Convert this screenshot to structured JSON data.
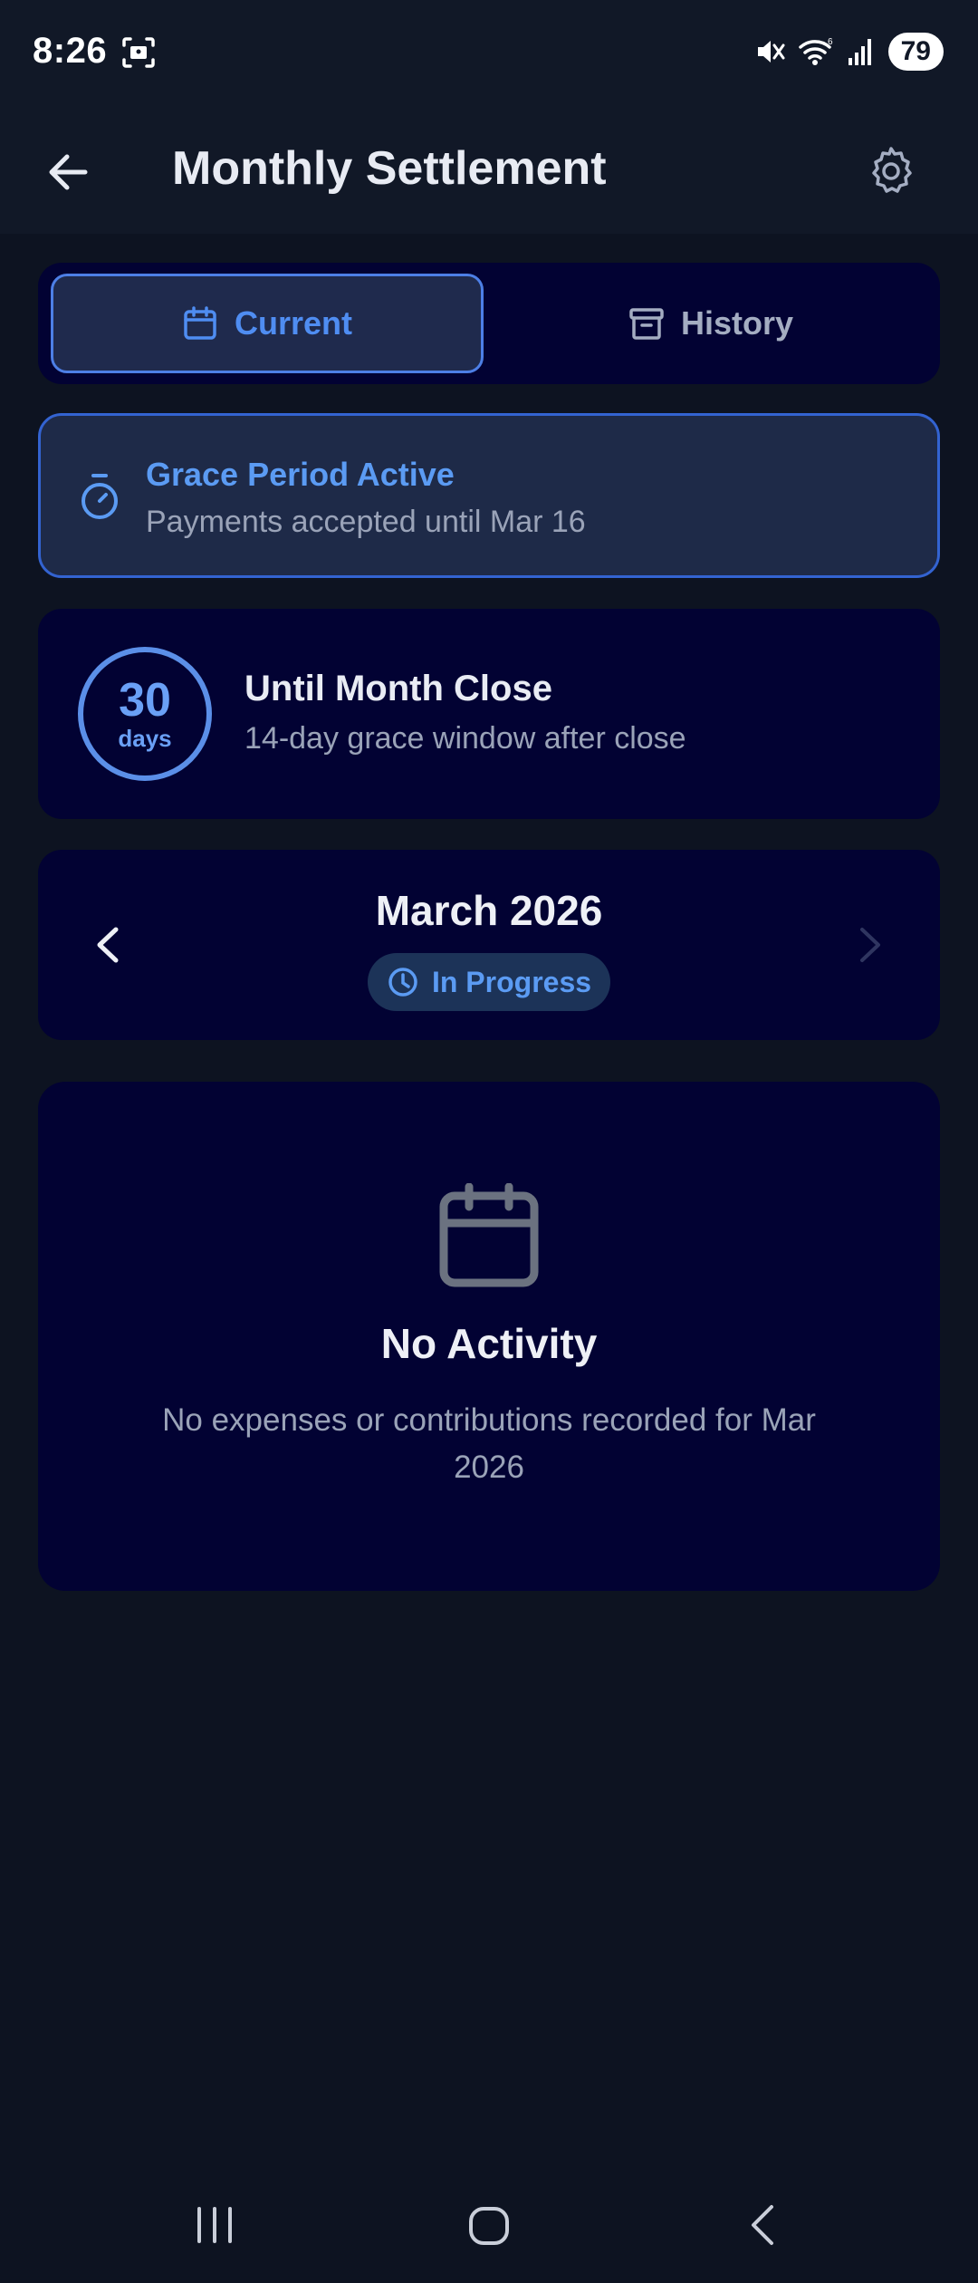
{
  "status_bar": {
    "time": "8:26",
    "battery": "79"
  },
  "header": {
    "title": "Monthly Settlement"
  },
  "tabs": [
    {
      "label": "Current",
      "icon": "calendar-icon",
      "selected": true
    },
    {
      "label": "History",
      "icon": "archive-icon",
      "selected": false
    }
  ],
  "grace_banner": {
    "title": "Grace Period Active",
    "subtitle": "Payments accepted until Mar 16",
    "icon": "stopwatch-icon"
  },
  "countdown": {
    "number": "30",
    "unit": "days",
    "title": "Until Month Close",
    "subtitle": "14-day grace window after close"
  },
  "month_nav": {
    "month": "March 2026",
    "status": "In Progress"
  },
  "empty_state": {
    "title": "No Activity",
    "message": "No expenses or contributions recorded for Mar 2026"
  },
  "colors": {
    "background": "#0d1321",
    "card": "#020233",
    "accent": "#4f8df2",
    "banner": "#1e2a48"
  }
}
